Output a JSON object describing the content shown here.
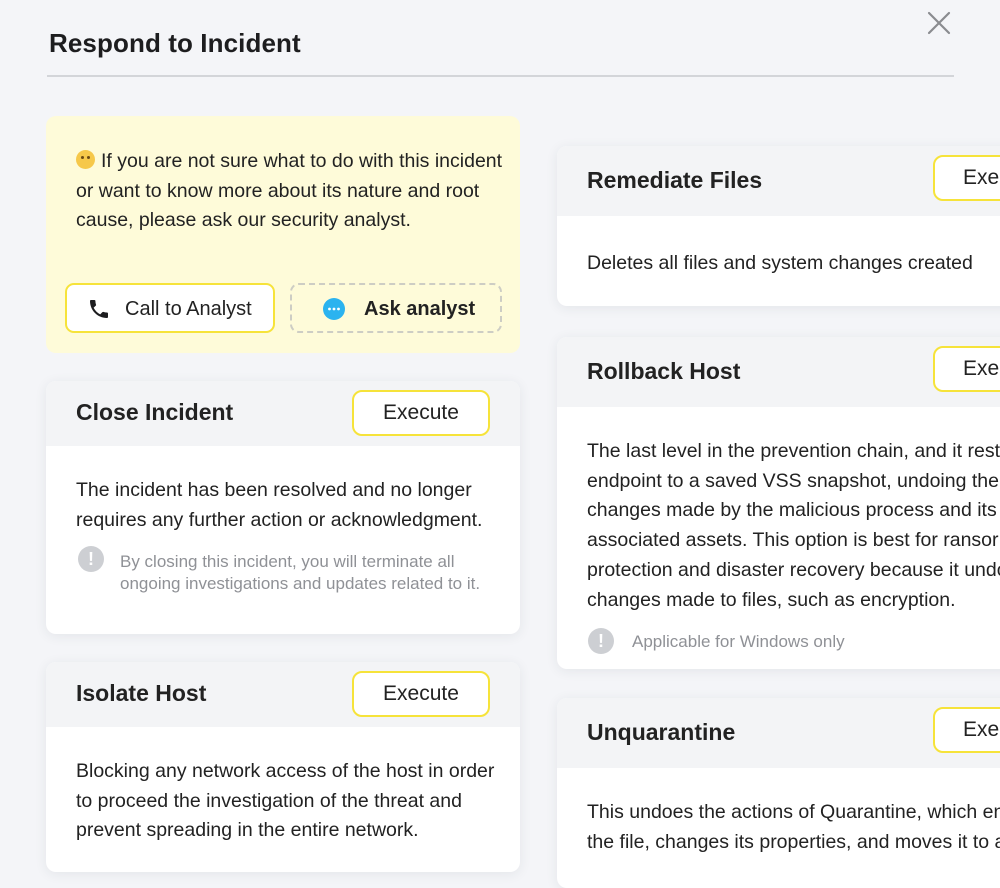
{
  "dialog": {
    "title": "Respond to Incident"
  },
  "help": {
    "message": "If you are not sure what to do with this incident or want to know more about its nature and root cause, please ask our security analyst.",
    "call_label": "Call to Analyst",
    "ask_label": "Ask analyst"
  },
  "actions": {
    "execute_label": "Execute",
    "execute_label_cut": "Exe",
    "close_incident": {
      "title": "Close Incident",
      "description": "The incident has been resolved and no longer requires any further action or acknowledgment.",
      "note": "By closing this incident, you will terminate all ongoing investigations and updates related to it."
    },
    "isolate_host": {
      "title": "Isolate Host",
      "description": "Blocking any network access of the host in order to proceed the investigation of the threat and prevent spreading in the entire network."
    },
    "remediate_files": {
      "title": "Remediate Files",
      "description": "Deletes all files and system changes created"
    },
    "rollback_host": {
      "title": "Rollback Host",
      "description_lines": [
        "The last level in the prevention chain, and it resto",
        "endpoint to a saved VSS snapshot, undoing the",
        "changes made by the malicious process and its",
        "associated assets. This option is best for ransor",
        "protection and disaster recovery because it undo",
        "changes made to files, such as encryption."
      ],
      "note": "Applicable for Windows only"
    },
    "unquarantine": {
      "title": "Unquarantine",
      "description_lines": [
        "This undoes the actions of Quarantine, which en",
        "the file, changes its properties, and moves it to a"
      ]
    }
  },
  "colors": {
    "accent_border": "#f6e33a",
    "help_background": "#fefbd9",
    "chat_icon": "#2bb3ef"
  },
  "icons": {
    "close": "close-icon",
    "phone": "phone-icon",
    "chat": "chat-bubble-icon",
    "warning": "exclamation-icon",
    "emoji": "thinking-emoji-icon"
  }
}
